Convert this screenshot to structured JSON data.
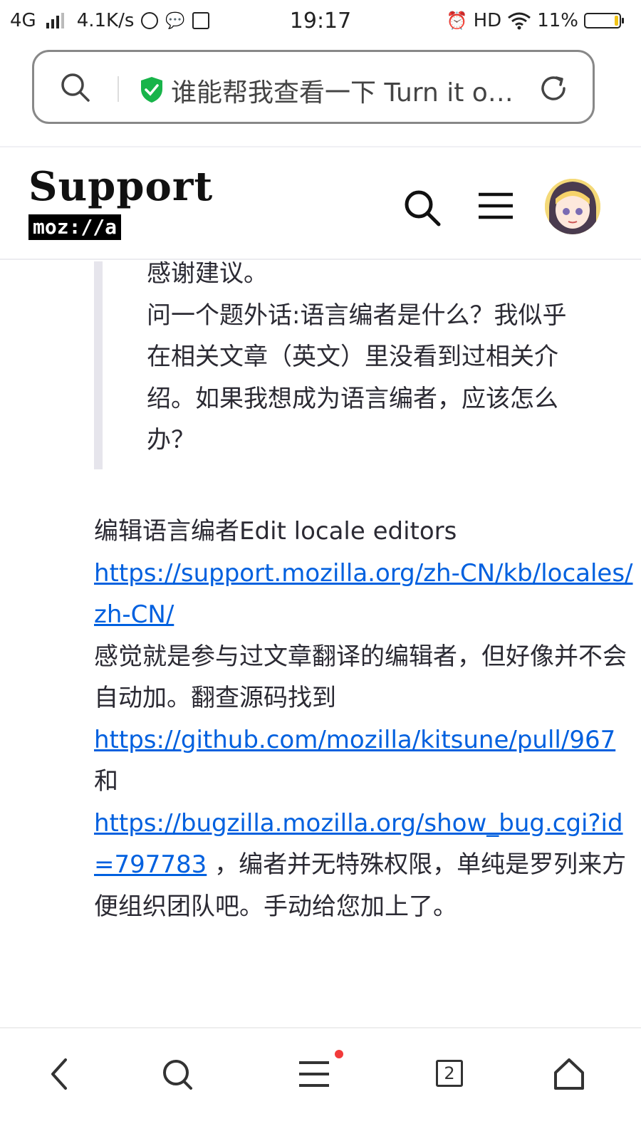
{
  "status": {
    "network": "4G",
    "speed": "4.1K/s",
    "time": "19:17",
    "hd": "HD",
    "battery_text": "11%",
    "battery_level": 0.11,
    "battery_color": "#f2c417"
  },
  "urlbar": {
    "text": "谁能帮我查看一下 Turn it o…",
    "secure_color": "#18b44a"
  },
  "header": {
    "logo_word": "Support",
    "logo_sub": "moz://a"
  },
  "quote": {
    "partial_line": "感谢建议。",
    "text": "问一个题外话:语言编者是什么？我似乎在相关文章（英文）里没看到过相关介绍。如果我想成为语言编者，应该怎么办？"
  },
  "reply": {
    "line1": "编辑语言编者Edit locale editors",
    "link1": "https://support.mozilla.org/zh-CN/kb/locales/zh-CN/",
    "text2": "感觉就是参与过文章翻译的编辑者，但好像并不会自动加。翻查源码找到",
    "link2": "https://github.com/mozilla/kitsune/pull/967",
    "and": " 和",
    "link3": "https://bugzilla.mozilla.org/show_bug.cgi?id=797783",
    "text3": " ，编者并无特殊权限，单纯是罗列来方便组织团队吧。手动给您加上了。"
  },
  "toolbar": {
    "tab_count": "2",
    "link_color": "#0060df"
  }
}
